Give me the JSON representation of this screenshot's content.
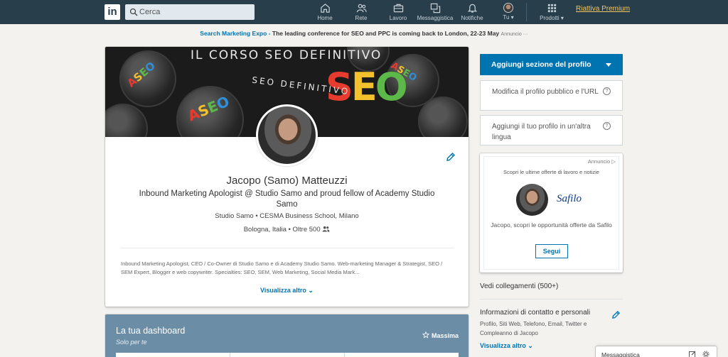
{
  "nav": {
    "logo": "in",
    "search_placeholder": "Cerca",
    "items": [
      {
        "label": "Home"
      },
      {
        "label": "Rete"
      },
      {
        "label": "Lavoro"
      },
      {
        "label": "Messaggistica"
      },
      {
        "label": "Notifiche"
      },
      {
        "label": "Tu ▾"
      },
      {
        "label": "Prodotti ▾"
      }
    ],
    "premium": "Riattiva Premium"
  },
  "ad_banner": {
    "link": "Search Marketing Expo -",
    "text": "The leading conference for SEO and PPC is coming back to London, 22-23 May",
    "label": "Annuncio ···"
  },
  "profile": {
    "cover_text": "IL CORSO SEO DEFINITIVO",
    "cover_text_2": "SEO DEFINITIVO",
    "name": "Jacopo (Samo) Matteuzzi",
    "headline": "Inbound Marketing Apologist @ Studio Samo and proud fellow of Academy Studio Samo",
    "company_school": "Studio Samo • CESMA Business School, Milano",
    "location": "Bologna, Italia • Oltre 500",
    "summary": "Inbound Marketing Apologist, CEO / Co-Owner di Studio Samo e di Academy Studio Samo. Web-marketing Manager & Strategist, SEO / SEM Expert, Blogger e web copywriter. Specialties: SEO, SEM, Web Marketing, Social Media Mark...",
    "show_more": "Visualizza altro ⌄"
  },
  "dashboard": {
    "title": "La tua dashboard",
    "subtitle": "Solo per te",
    "level": "Massima"
  },
  "rail": {
    "add_section": "Aggiungi sezione del profilo",
    "edit_public": "Modifica il profilo pubblico e l'URL",
    "add_language": "Aggiungi il tuo profilo in un'altra lingua",
    "ad": {
      "label": "Annuncio ▷",
      "line1": "Scopri le ultime offerte di lavoro e notizie",
      "brand": "Safilo",
      "text": "Jacopo, scopri le opportunità offerte da Safilo",
      "button": "Segui"
    },
    "connections": "Vedi collegamenti (500+)",
    "contact_title": "Informazioni di contatto e personali",
    "contact_text": "Profilo, Siti Web, Telefono, Email, Twitter e Compleanno di Jacopo",
    "contact_more": "Visualizza altro ⌄"
  },
  "messaging": {
    "label": "Messaggistica"
  },
  "colors": {
    "nav_bg": "#283e4a",
    "accent": "#0073b1",
    "premium": "#f5c75d",
    "dashboard_bg": "#6b8da6"
  }
}
